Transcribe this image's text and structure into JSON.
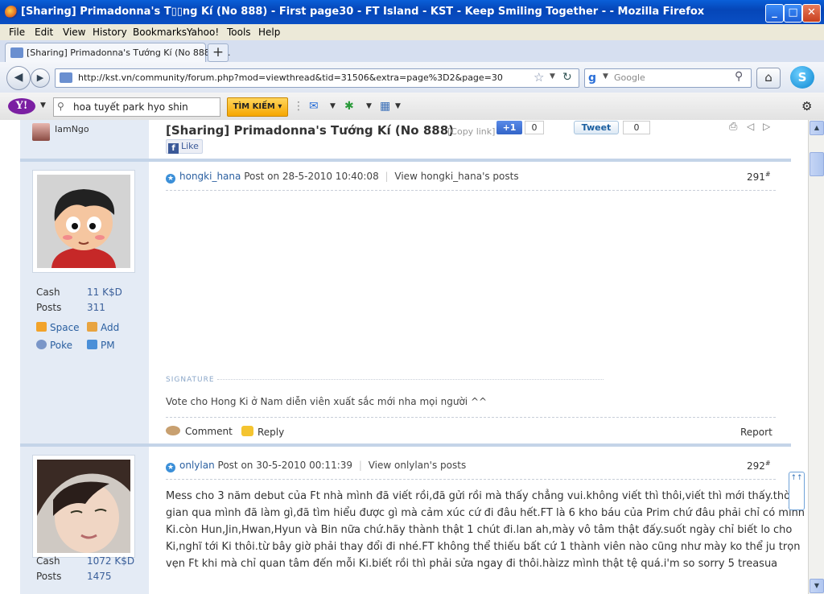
{
  "window": {
    "title": "[Sharing] Primadonna's T▯▯ng Kí (No 888) - First page30 - FT Island - KST - Keep Smiling Together - - Mozilla Firefox",
    "minimize": "_",
    "maximize": "□",
    "close": "✕"
  },
  "menu": [
    "File",
    "Edit",
    "View",
    "History",
    "Bookmarks",
    "Yahoo!",
    "Tools",
    "Help"
  ],
  "tab": {
    "label": "[Sharing] Primadonna's Tướng Kí (No 888) - ...",
    "close": "×",
    "new_tab": "+"
  },
  "nav": {
    "url": "http://kst.vn/community/forum.php?mod=viewthread&tid=31506&extra=page%3D2&page=30",
    "search_placeholder": "Google"
  },
  "yahoo": {
    "logo": "Y!",
    "query": "hoa tuyết park hyo shin",
    "search_button": "TÌM KIẾM ▾"
  },
  "thread": {
    "op_name": "IamNgo",
    "title": "[Sharing] Primadonna's Tướng Kí (No 888)",
    "copy_link": "[Copy link]",
    "gplus": "+1",
    "gplus_count": "0",
    "tweet": "Tweet",
    "tweet_count": "0",
    "like": "Like"
  },
  "posts": [
    {
      "user": "hongki_hana",
      "posted": "Post on 28-5-2010 10:40:08",
      "view_posts": "View hongki_hana's posts",
      "floor": "291",
      "signature_label": "SIGNATURE",
      "signature": "Vote cho Hong Ki ở Nam diễn viên xuất sắc mới nha mọi người ^^",
      "stats": [
        {
          "label": "Cash",
          "value": "11 K$D"
        },
        {
          "label": "Posts",
          "value": "311"
        }
      ],
      "actions": {
        "space": "Space",
        "add": "Add",
        "poke": "Poke",
        "pm": "PM"
      },
      "comment": "Comment",
      "reply": "Reply",
      "report": "Report"
    },
    {
      "user": "onlylan",
      "posted": "Post on 30-5-2010 00:11:39",
      "view_posts": "View onlylan's posts",
      "floor": "292",
      "body_lines": [
        "Mess cho 3 năm debut của Ft nhà mình đã viết rồi,đã gửi rồi mà thấy chẳng vui.không viết thì thôi,viết thì mới thấy.thời",
        "gian qua mình đã làm gì,đã tìm hiểu được gì mà cảm xúc cứ đi đâu hết.FT là 6 kho báu của Prim chứ đâu phải chỉ có mình",
        "Ki.còn Hun,Jin,Hwan,Hyun và Bin nữa chứ.hãy thành thật 1 chút đi.lan ah,mày vô tâm thật đấy.suốt ngày chỉ biết lo cho",
        "Ki,nghĩ tới Ki thôi.từ bây giờ phải thay đổi đi nhé.FT không thể thiếu bất cứ 1 thành viên nào cũng như mày ko thể ju trọn",
        "vẹn Ft khi mà chỉ quan tâm đến mỗi Ki.biết rồi thì phải sửa ngay đi thôi.hàizz mình thật tệ quá.i'm so sorry 5 treasua"
      ],
      "stats": [
        {
          "label": "Cash",
          "value": "1072 K$D"
        },
        {
          "label": "Posts",
          "value": "1475"
        }
      ]
    }
  ],
  "back_to_top": "↑↑"
}
